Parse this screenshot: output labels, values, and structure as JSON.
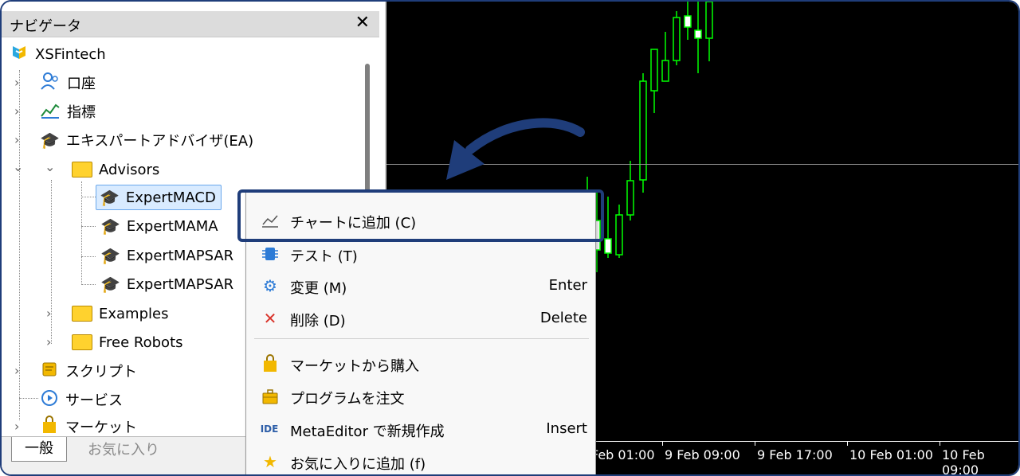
{
  "navigator": {
    "title": "ナビゲータ",
    "close_label": "✕",
    "root": "XSFintech",
    "items": {
      "account": "口座",
      "indicators": "指標",
      "experts": "エキスパートアドバイザ(EA)",
      "advisors": "Advisors",
      "expert_macd": "ExpertMACD",
      "expert_mama": "ExpertMAMA",
      "expert_mapsar1": "ExpertMAPSAR",
      "expert_mapsar2": "ExpertMAPSAR",
      "examples": "Examples",
      "free_robots": "Free Robots",
      "scripts": "スクリプト",
      "services": "サービス",
      "market": "マーケット"
    },
    "tabs": {
      "general": "一般",
      "favorites": "お気に入り"
    }
  },
  "chart": {
    "x_labels": [
      "Feb 01:00",
      "9 Feb 09:00",
      "9 Feb 17:00",
      "10 Feb 01:00",
      "10 Feb 09:00"
    ],
    "colors": {
      "background": "#000000",
      "bull": "#00ff00",
      "bear_fill": "#ffffff"
    }
  },
  "context_menu": {
    "items": [
      {
        "label": "チャートに追加 (C)",
        "shortcut": "",
        "icon": "chart-line-icon"
      },
      {
        "label": "テスト (T)",
        "shortcut": "",
        "icon": "chip-icon"
      },
      {
        "label": "変更 (M)",
        "shortcut": "Enter",
        "icon": "gear-icon"
      },
      {
        "label": "削除 (D)",
        "shortcut": "Delete",
        "icon": "delete-x-icon"
      },
      {
        "label": "マーケットから購入",
        "shortcut": "",
        "icon": "shopping-bag-icon"
      },
      {
        "label": "プログラムを注文",
        "shortcut": "",
        "icon": "briefcase-icon"
      },
      {
        "label": "MetaEditor で新規作成",
        "shortcut": "Insert",
        "icon": "ide-icon"
      },
      {
        "label": "お気に入りに追加 (f)",
        "shortcut": "",
        "icon": "star-icon"
      }
    ],
    "ide_text": "IDE"
  }
}
